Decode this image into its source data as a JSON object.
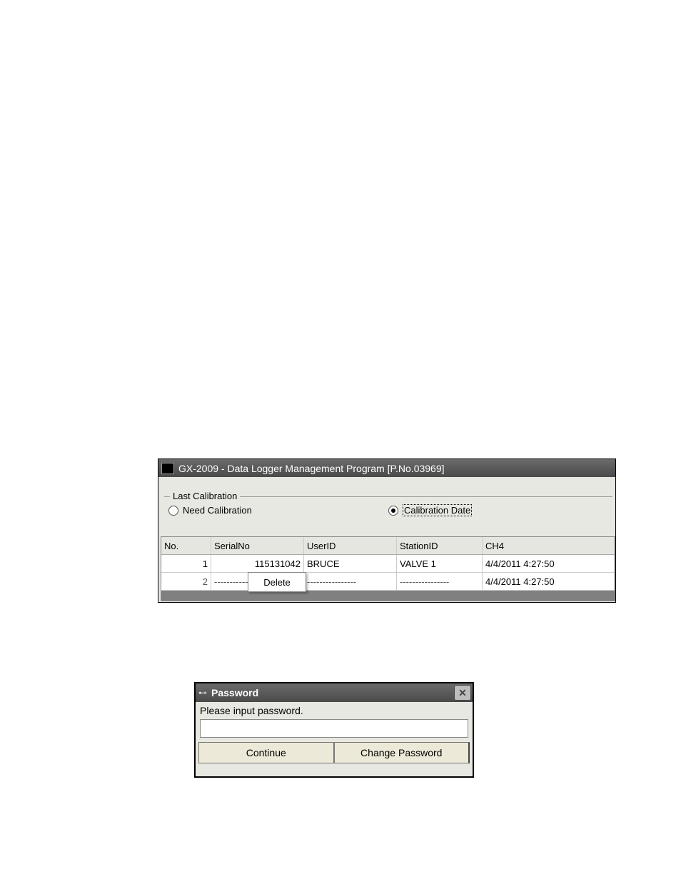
{
  "fig1": {
    "title": "GX-2009  - Data Logger Management Program [P.No.03969]",
    "group_legend": "Last Calibration",
    "radios": {
      "need": "Need Calibration",
      "date": "Calibration Date"
    },
    "columns": {
      "no": "No.",
      "serial": "SerialNo",
      "user": "UserID",
      "station": "StationID",
      "ch4": "CH4"
    },
    "rows": [
      {
        "no": "1",
        "serial": "115131042",
        "user": "BRUCE",
        "station": "VALVE 1",
        "ch4": "4/4/2011 4:27:50"
      },
      {
        "no": "2",
        "serial": "-----------",
        "user": "----------------",
        "station": "----------------",
        "ch4": "4/4/2011 4:27:50"
      }
    ],
    "context_menu": "Delete"
  },
  "fig2": {
    "title": "Password",
    "close": "✕",
    "prompt": "Please input password.",
    "continue": "Continue",
    "change": "Change Password"
  }
}
